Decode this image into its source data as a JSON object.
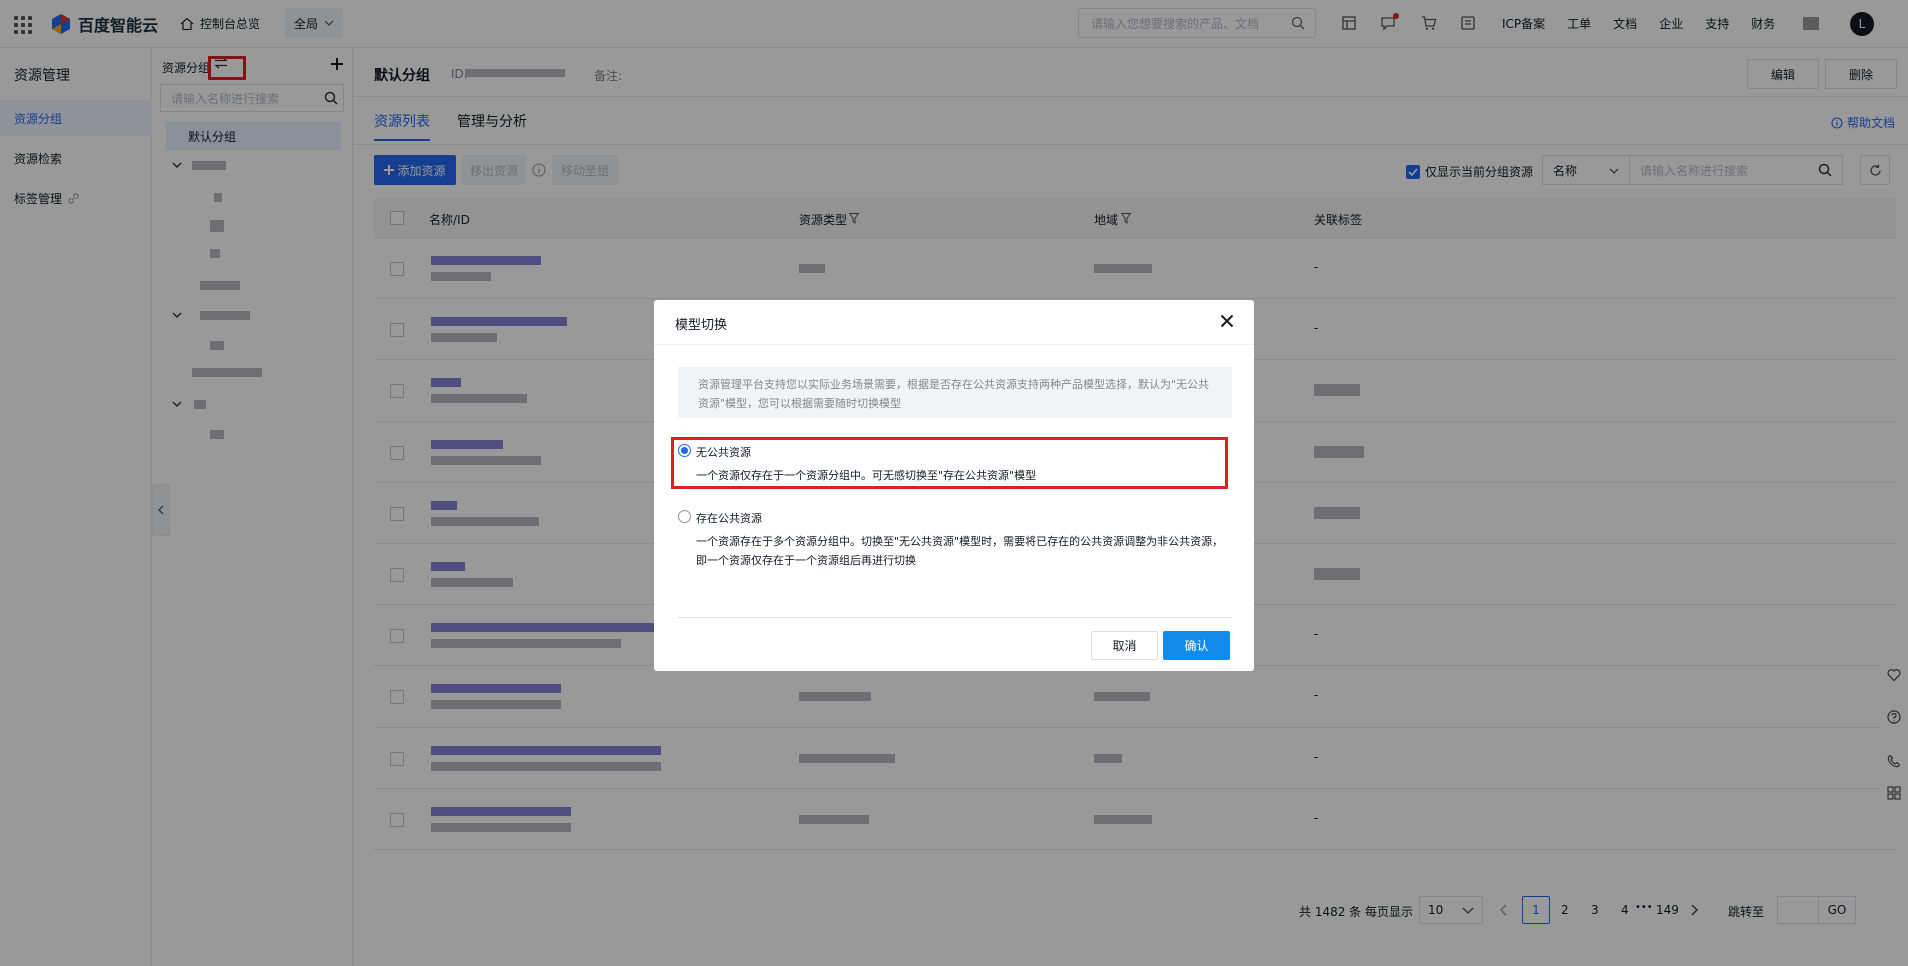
{
  "topbar": {
    "brand": "百度智能云",
    "console_home": "控制台总览",
    "region": "全局",
    "search_placeholder": "请输入您想要搜索的产品、文档",
    "links": [
      "ICP备案",
      "工单",
      "文档",
      "企业",
      "支持",
      "财务"
    ],
    "avatar_letter": "L"
  },
  "left_nav": {
    "title": "资源管理",
    "items": [
      {
        "label": "资源分组",
        "active": true
      },
      {
        "label": "资源检索",
        "active": false
      },
      {
        "label": "标签管理",
        "active": false
      }
    ]
  },
  "tree": {
    "title": "资源分组",
    "search_placeholder": "请输入名称进行搜索",
    "selected": "默认分组"
  },
  "group_header": {
    "name": "默认分组",
    "id_label": "ID:",
    "note_label": "备注:",
    "edit": "编辑",
    "delete": "删除"
  },
  "tabs": [
    {
      "label": "资源列表",
      "active": true
    },
    {
      "label": "管理与分析",
      "active": false
    }
  ],
  "help_doc": "帮助文档",
  "toolbar": {
    "add": "添加资源",
    "remove": "移出资源",
    "move": "移动至组",
    "only_current_label": "仅显示当前分组资源",
    "filter_field": "名称",
    "search_placeholder": "请输入名称进行搜索"
  },
  "table": {
    "columns": [
      "名称/ID",
      "资源类型",
      "地域",
      "关联标签"
    ],
    "tags_col": [
      "-",
      "-",
      "",
      "",
      "",
      "",
      "-",
      "-",
      "-",
      "-"
    ]
  },
  "pagination": {
    "total": "共 1482 条",
    "per_page_label": "每页显示",
    "per_page": "10",
    "pages": [
      "1",
      "2",
      "3",
      "4"
    ],
    "ellipsis": "•••",
    "last": "149",
    "jump_label": "跳转至",
    "go": "GO"
  },
  "modal": {
    "title": "模型切换",
    "info": "资源管理平台支持您以实际业务场景需要，根据是否存在公共资源支持两种产品模型选择，默认为\"无公共资源\"模型，您可以根据需要随时切换模型",
    "options": [
      {
        "label": "无公共资源",
        "desc": "一个资源仅存在于一个资源分组中。可无感切换至\"存在公共资源\"模型",
        "checked": true
      },
      {
        "label": "存在公共资源",
        "desc": "一个资源存在于多个资源分组中。切换至\"无公共资源\"模型时，需要将已存在的公共资源调整为非公共资源，即一个资源仅存在于一个资源组后再进行切换",
        "checked": false
      }
    ],
    "cancel": "取消",
    "confirm": "确认"
  },
  "colors": {
    "primary": "#2468f2",
    "confirm": "#108cee",
    "highlight": "#e02020",
    "overlay": "rgba(0,0,0,0.4)"
  }
}
